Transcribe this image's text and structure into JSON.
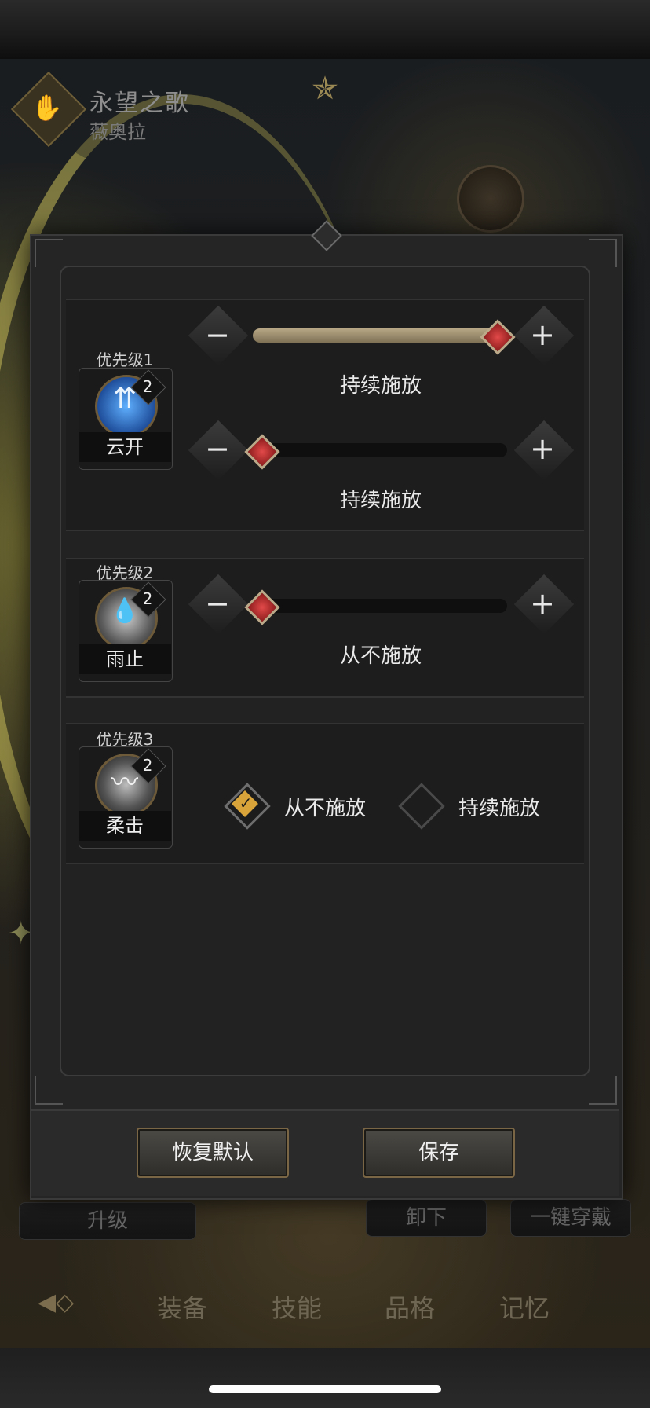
{
  "background": {
    "title": "永望之歌",
    "subtitle": "薇奥拉",
    "buttons": {
      "upgrade": "升级",
      "unequip": "卸下",
      "one_click_equip": "一键穿戴"
    },
    "tabs": [
      "装备",
      "技能",
      "品格",
      "记忆"
    ]
  },
  "skills": [
    {
      "priority": "优先级1",
      "name": "云开",
      "level": "2",
      "sliders": [
        {
          "value": 1.0,
          "label": "持续施放",
          "minus": "−",
          "plus": "+"
        },
        {
          "value": 0.0,
          "label": "持续施放",
          "minus": "−",
          "plus": "+"
        }
      ]
    },
    {
      "priority": "优先级2",
      "name": "雨止",
      "level": "2",
      "sliders": [
        {
          "value": 0.0,
          "label": "从不施放",
          "minus": "−",
          "plus": "+"
        }
      ]
    },
    {
      "priority": "优先级3",
      "name": "柔击",
      "level": "2",
      "options": [
        {
          "label": "从不施放",
          "selected": true
        },
        {
          "label": "持续施放",
          "selected": false
        }
      ]
    }
  ],
  "actions": {
    "restore_default": "恢复默认",
    "save": "保存"
  },
  "colors": {
    "accent_gold": "#d9a53a",
    "thumb_red": "#c93333"
  }
}
